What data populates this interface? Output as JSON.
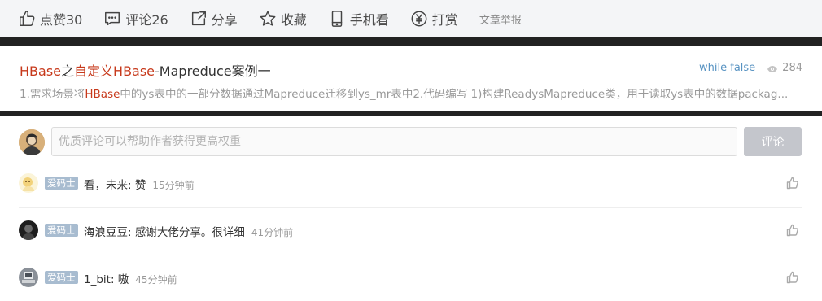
{
  "toolbar": {
    "like_label": "点赞30",
    "comment_label": "评论26",
    "share_label": "分享",
    "collect_label": "收藏",
    "mobile_label": "手机看",
    "reward_label": "打赏",
    "report_label": "文章举报"
  },
  "related": {
    "title_part1": "HBase",
    "title_part2": "之",
    "title_part3": "自定义",
    "title_part4": "HBase",
    "title_part5": "-Mapreduce案例一",
    "author": "while false",
    "views": "284",
    "desc_part1": "1.需求场景将",
    "desc_part2": "HBase",
    "desc_part3": "中的ys表中的一部分数据通过Mapreduce迁移到ys_mr表中2.代码编写  1)构建ReadysMapreduce类，用于读取ys表中的数据packag..."
  },
  "comment_input": {
    "placeholder": "优质评论可以帮助作者获得更高权重",
    "submit_label": "评论"
  },
  "comments": [
    {
      "badge": "爱码士",
      "text": "看，未来: 赞",
      "time": "15分钟前"
    },
    {
      "badge": "爱码士",
      "text": "海浪豆豆: 感谢大佬分享。很详细",
      "time": "41分钟前"
    },
    {
      "badge": "爱码士",
      "text": "1_bit: 嗷",
      "time": "45分钟前"
    }
  ],
  "colors": {
    "highlight": "#c7391b",
    "author_link": "#5893c2",
    "badge_bg": "#a8bcd0",
    "submit_bg": "#c4c6cc"
  },
  "icons": [
    "thumbs-up-icon",
    "comment-icon",
    "share-icon",
    "star-icon",
    "phone-icon",
    "yen-icon",
    "eye-icon"
  ]
}
